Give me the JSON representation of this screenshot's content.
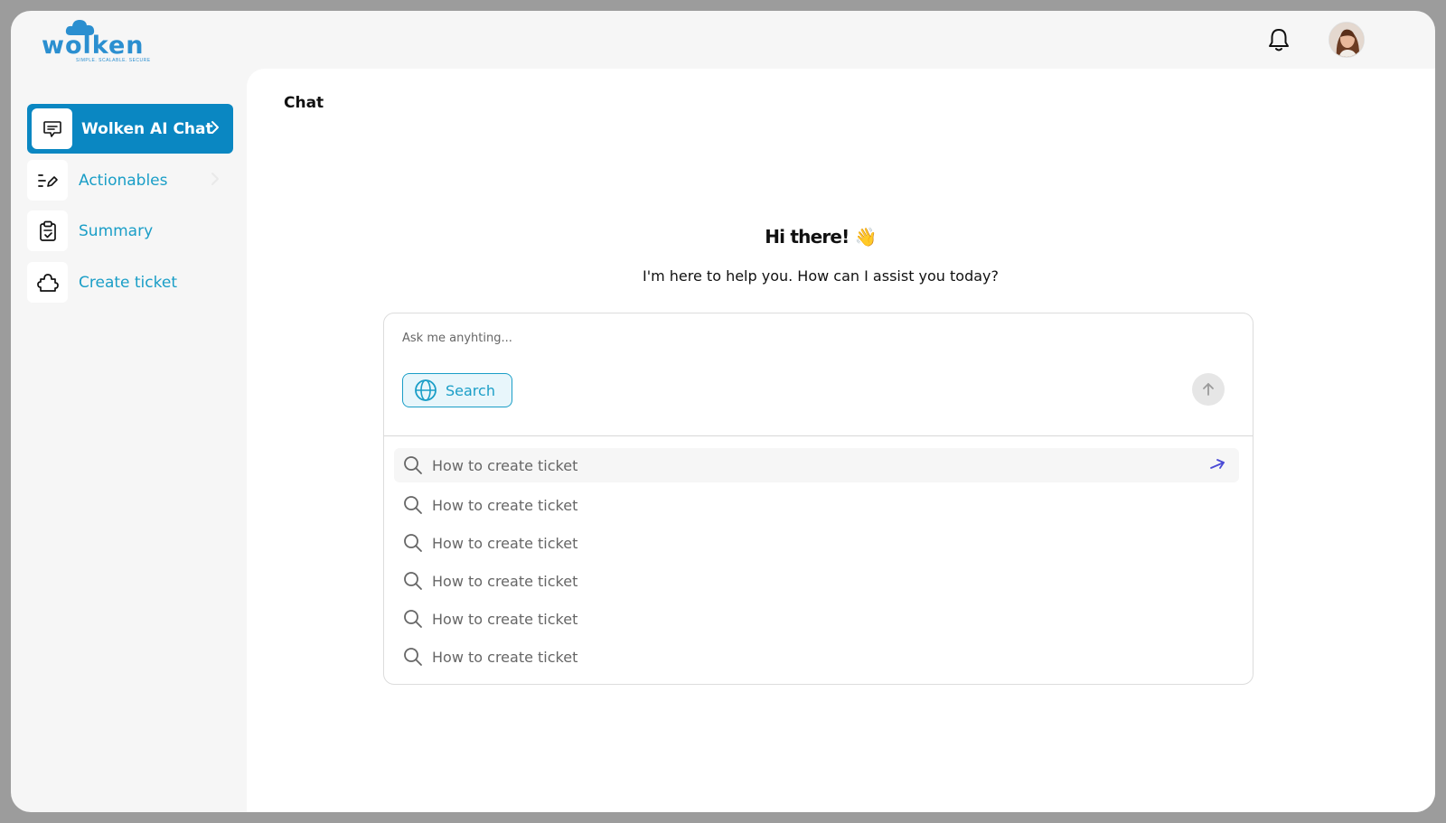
{
  "app": {
    "logo_text": "wolken",
    "logo_tagline": "SIMPLE. SCALABLE. SECURE"
  },
  "header": {
    "notification_icon": "bell-icon",
    "avatar_icon": "user-avatar"
  },
  "sidebar": {
    "items": [
      {
        "label": "Wolken AI Chat",
        "icon": "chat-bubble-icon",
        "active": true
      },
      {
        "label": "Actionables",
        "icon": "list-edit-icon",
        "active": false
      },
      {
        "label": "Summary",
        "icon": "clipboard-check-icon",
        "active": false
      },
      {
        "label": "Create ticket",
        "icon": "puzzle-icon",
        "active": false
      }
    ]
  },
  "main": {
    "title": "Chat",
    "greeting": "Hi there!",
    "greeting_emoji": "👋",
    "subtitle": "I'm here to help you. How can I assist you today?",
    "input_placeholder": "Ask me anyhting...",
    "search_label": "Search",
    "suggestions": [
      "How to create ticket",
      "How to create ticket",
      "How to create ticket",
      "How to create ticket",
      "How to create ticket",
      "How to create ticket"
    ]
  },
  "colors": {
    "accent": "#0a87c2",
    "accent_text": "#1a9ec7",
    "send_arrow": "#4a4ad6"
  }
}
